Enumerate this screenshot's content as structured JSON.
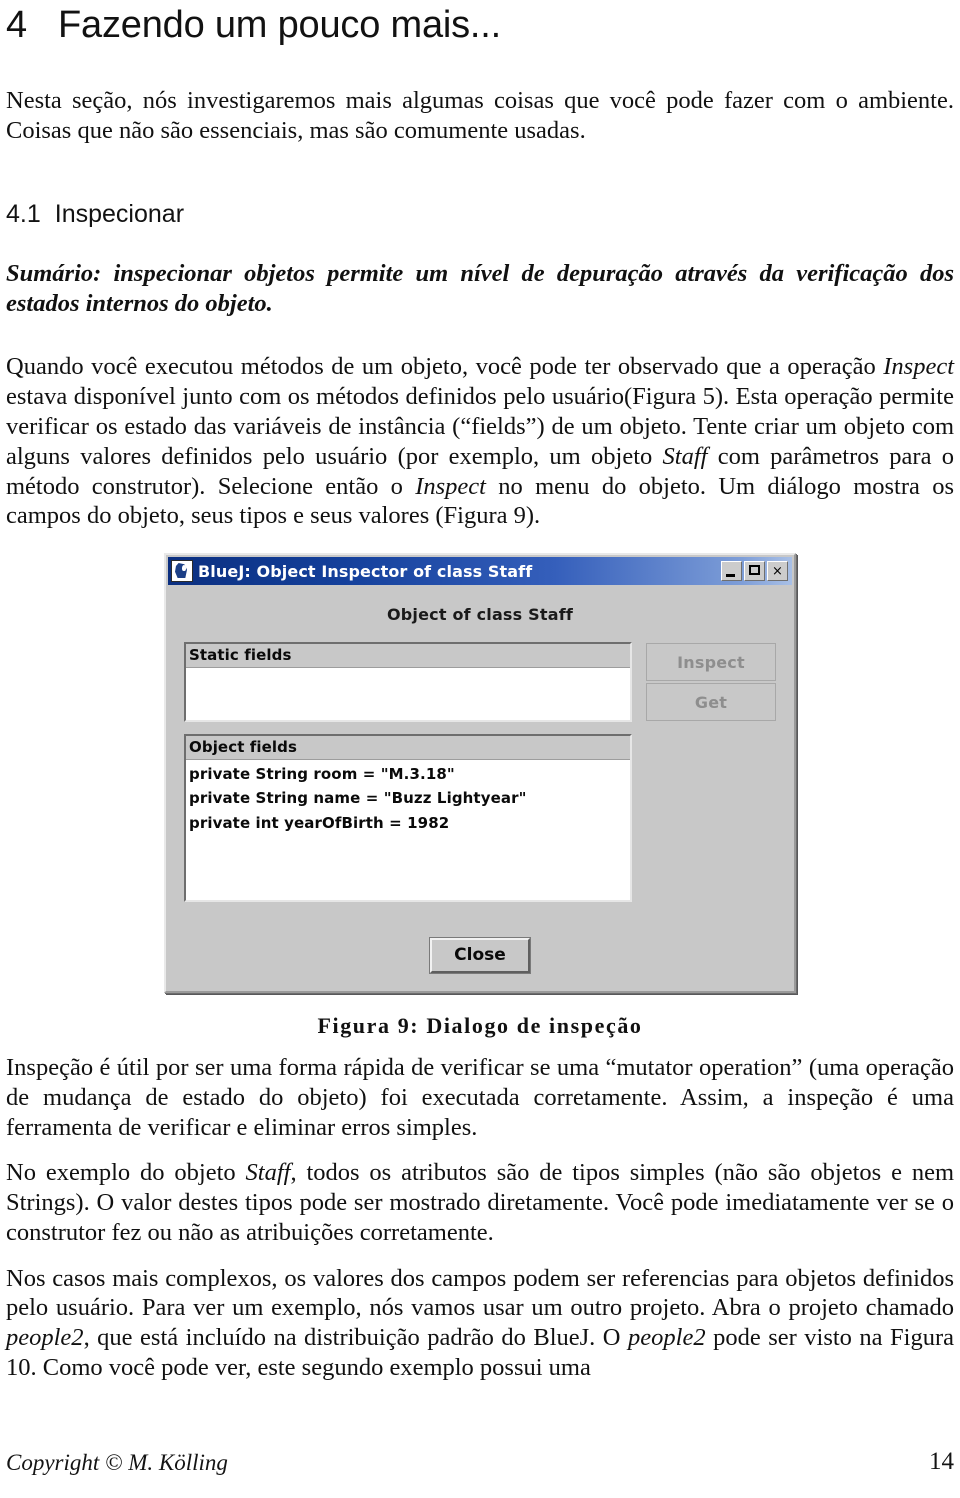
{
  "document": {
    "section_heading": {
      "number": "4",
      "title": "Fazendo um pouco mais..."
    },
    "intro_paragraph": "Nesta seção, nós investigaremos mais algumas coisas que você pode fazer com o ambiente. Coisas que não são essenciais, mas são comumente usadas.",
    "subsection_heading": {
      "number": "4.1",
      "title": "Inspecionar"
    },
    "summary": "Sumário: inspecionar objetos permite um nível de depuração através da verificação dos estados internos do objeto.",
    "paragraph_1": {
      "part_1": "Quando você executou métodos de um objeto, você pode ter observado que a operação ",
      "italic_1": "Inspect",
      "part_2": " estava disponível junto com os métodos definidos pelo usuário(Figura 5). Esta operação permite verificar os estado das variáveis de instância (“fields”)  de um objeto. Tente criar um objeto com alguns valores definidos pelo usuário (por exemplo, um objeto ",
      "italic_2": "Staff",
      "part_3": " com parâmetros para o método construtor). Selecione então o ",
      "italic_3": "Inspect",
      "part_4": " no menu do objeto. Um diálogo mostra os campos do objeto, seus tipos e seus valores (Figura 9)."
    },
    "paragraph_2": "Inspeção é útil por ser uma forma rápida de verificar se uma “mutator operation” (uma operação de mudança de estado do objeto) foi executada corretamente. Assim, a inspeção é uma ferramenta de verificar e eliminar erros simples.",
    "paragraph_3": {
      "part_1": "No exemplo do objeto ",
      "italic_1": "Staff",
      "part_2": ", todos os atributos são de tipos simples (não são objetos e nem Strings). O valor destes tipos pode ser mostrado diretamente. Você pode imediatamente ver se o construtor fez ou não as atribuições corretamente."
    },
    "paragraph_4": {
      "part_1": "Nos casos mais complexos, os valores dos campos podem ser referencias para objetos definidos pelo usuário. Para ver um exemplo, nós vamos usar um outro projeto. Abra o projeto chamado ",
      "italic_1": "people2",
      "part_2": ", que está incluído na distribuição padrão do BlueJ. O ",
      "italic_2": "people2",
      "part_3": " pode ser visto na Figura 10. Como você pode ver, este segundo exemplo possui uma"
    },
    "figure_caption": "Figura 9: Dialogo de inspeção"
  },
  "bluej_dialog": {
    "title": "BlueJ: Object Inspector of class Staff",
    "icon_name": "bluej-app-icon",
    "window_buttons": {
      "minimize": "_",
      "maximize": "□",
      "close": "×"
    },
    "object_heading": "Object of class Staff",
    "static_fields": {
      "header": "Static fields",
      "items": []
    },
    "object_fields": {
      "header": "Object fields",
      "items": [
        "private String room = \"M.3.18\"",
        "private String name = \"Buzz Lightyear\"",
        "private int yearOfBirth = 1982"
      ]
    },
    "buttons": {
      "inspect": "Inspect",
      "get": "Get",
      "close": "Close"
    },
    "colors": {
      "titlebar_start": "#0b2f80",
      "titlebar_end": "#a9c0e6",
      "face": "#c8c8c8",
      "disabled_text": "#8e8e8e"
    }
  },
  "footer": {
    "copyright": "Copyright © M. Kölling",
    "page_number": "14"
  }
}
